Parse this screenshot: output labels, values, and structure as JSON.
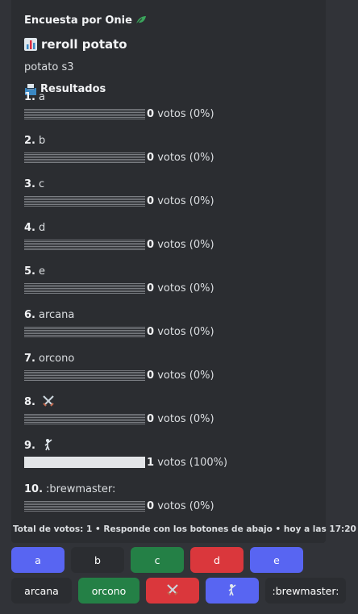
{
  "poll": {
    "author": "Encuesta por Onie",
    "title": "reroll potato",
    "description": "potato s3",
    "results_heading": "Resultados",
    "options": [
      {
        "num": "1.",
        "label": "a",
        "count": "0",
        "text": "votos (0%)",
        "fraction": 0
      },
      {
        "num": "2.",
        "label": "b",
        "count": "0",
        "text": "votos (0%)",
        "fraction": 0
      },
      {
        "num": "3.",
        "label": "c",
        "count": "0",
        "text": "votos (0%)",
        "fraction": 0
      },
      {
        "num": "4.",
        "label": "d",
        "count": "0",
        "text": "votos (0%)",
        "fraction": 0
      },
      {
        "num": "5.",
        "label": "e",
        "count": "0",
        "text": "votos (0%)",
        "fraction": 0
      },
      {
        "num": "6.",
        "label": "arcana",
        "count": "0",
        "text": "votos (0%)",
        "fraction": 0
      },
      {
        "num": "7.",
        "label": "orcono",
        "count": "0",
        "text": "votos (0%)",
        "fraction": 0
      },
      {
        "num": "8.",
        "label": "",
        "icon": "crossed-swords-icon",
        "count": "0",
        "text": "votos (0%)",
        "fraction": 0
      },
      {
        "num": "9.",
        "label": "",
        "icon": "fencer-icon",
        "count": "1",
        "text": "votos (100%)",
        "fraction": 1
      },
      {
        "num": "10.",
        "label": ":brewmaster:",
        "count": "0",
        "text": "votos (0%)",
        "fraction": 0
      }
    ],
    "footer": "Total de votos: 1 • Responde con los botones de abajo • hoy a las 17:20"
  },
  "buttons": [
    {
      "label": "a",
      "color": "#5865f2"
    },
    {
      "label": "b",
      "color": "#2b2d31"
    },
    {
      "label": "c",
      "color": "#248046"
    },
    {
      "label": "d",
      "color": "#da373c"
    },
    {
      "label": "e",
      "color": "#5865f2"
    },
    {
      "label": "arcana",
      "color": "#2b2d31"
    },
    {
      "label": "orcono",
      "color": "#248046"
    },
    {
      "label": "",
      "icon": "crossed-swords-icon",
      "color": "#da373c"
    },
    {
      "label": "",
      "icon": "fencer-icon",
      "color": "#5865f2"
    },
    {
      "label": ":brewmaster:",
      "color": "#2b2d31"
    }
  ]
}
